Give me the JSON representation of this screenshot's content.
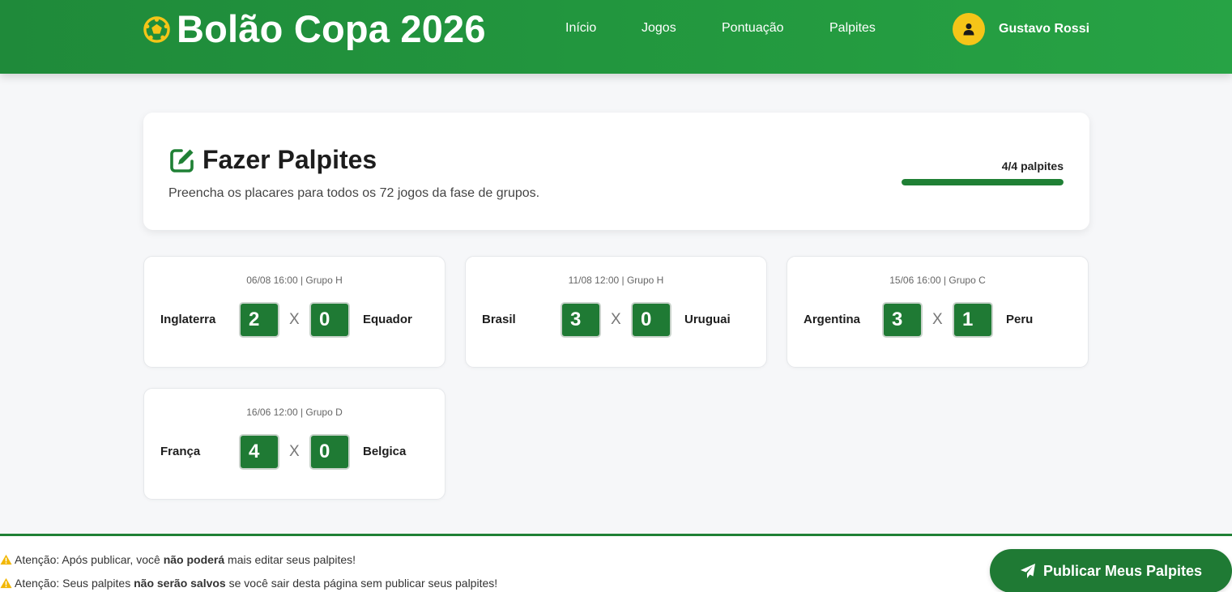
{
  "header": {
    "brand": "Bolão Copa 2026",
    "nav": [
      {
        "label": "Início"
      },
      {
        "label": "Jogos"
      },
      {
        "label": "Pontuação"
      },
      {
        "label": "Palpites"
      }
    ],
    "user_name": "Gustavo Rossi"
  },
  "page": {
    "title": "Fazer Palpites",
    "subtitle": "Preencha os placares para todos os 72 jogos da fase de grupos.",
    "progress_label": "4/4 palpites",
    "progress_fraction": 1.0
  },
  "matches": [
    {
      "meta": "06/08 16:00 | Grupo H",
      "home": "Inglaterra",
      "home_score": "2",
      "versus": "X",
      "away_score": "0",
      "away": "Equador"
    },
    {
      "meta": "11/08 12:00 | Grupo H",
      "home": "Brasil",
      "home_score": "3",
      "versus": "X",
      "away_score": "0",
      "away": "Uruguai"
    },
    {
      "meta": "15/06 16:00 | Grupo C",
      "home": "Argentina",
      "home_score": "3",
      "versus": "X",
      "away_score": "1",
      "away": "Peru"
    },
    {
      "meta": "16/06 12:00 | Grupo D",
      "home": "França",
      "home_score": "4",
      "versus": "X",
      "away_score": "0",
      "away": "Belgica"
    }
  ],
  "footer": {
    "warnings": [
      {
        "prefix": "Atenção: Após publicar, você ",
        "bold": "não poderá",
        "suffix": " mais editar seus palpites!"
      },
      {
        "prefix": "Atenção: Seus palpites ",
        "bold": "não serão salvos",
        "suffix": " se você sair desta página sem publicar seus palpites!"
      }
    ],
    "publish_label": "Publicar Meus Palpites"
  },
  "icons": {
    "brand": "soccer-ball-icon",
    "user": "user-icon",
    "title": "edit-icon",
    "warning": "warning-icon",
    "publish": "paper-plane-icon"
  },
  "colors": {
    "header_green": "#23993f",
    "accent_green": "#1f7a34",
    "avatar_yellow": "#f5c518",
    "warning_yellow": "#f2b705"
  }
}
